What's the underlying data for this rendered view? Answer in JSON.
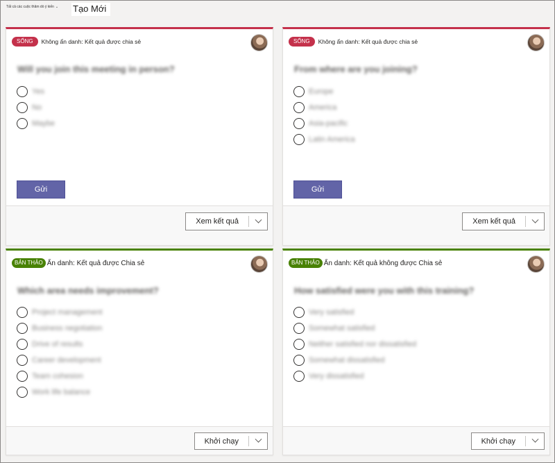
{
  "tabs": {
    "all_polls": "Tất cả các cuộc thăm dò ý kiến",
    "all_polls_chevron": "⌄",
    "new": "Tạo Mới"
  },
  "cards": [
    {
      "status": "SỐNG",
      "meta": "Không ẩn danh: Kết quả được chia sẻ",
      "question": "Will you join this meeting in person?",
      "options": [
        "Yes",
        "No",
        "Maybe"
      ],
      "submit": "Gửi",
      "action": "Xem kết quả"
    },
    {
      "status": "SỐNG",
      "meta": "Không ẩn danh: Kết quả được chia sẻ",
      "question": "From where are you joining?",
      "options": [
        "Europe",
        "America",
        "Asia-pacific",
        "Latin America"
      ],
      "submit": "Gửi",
      "action": "Xem kết quả"
    },
    {
      "status": "BẢN THẢO",
      "meta": "Ẩn danh: Kết quả được Chia sẻ",
      "question": "Which area needs improvement?",
      "options": [
        "Project management",
        "Business negotiation",
        "Drive of results",
        "Career development",
        "Team cohesion",
        "Work life balance"
      ],
      "action": "Khởi chạy"
    },
    {
      "status": "BẢN THẢO",
      "meta": "Ẩn danh: Kết quả không được Chia sẻ",
      "question": "How satisfied were you with this training?",
      "options": [
        "Very satisfied",
        "Somewhat satisfied",
        "Neither satisfied nor dissatisfied",
        "Somewhat dissatisfied",
        "Very dissatisfied"
      ],
      "action": "Khởi chạy"
    }
  ],
  "colors": {
    "live": "#c4314b",
    "draft": "#498205",
    "primary_button": "#6264a7"
  },
  "icons": {
    "avatar": "user-avatar",
    "dropdown": "chevron-down-icon",
    "radio": "radio-button"
  }
}
